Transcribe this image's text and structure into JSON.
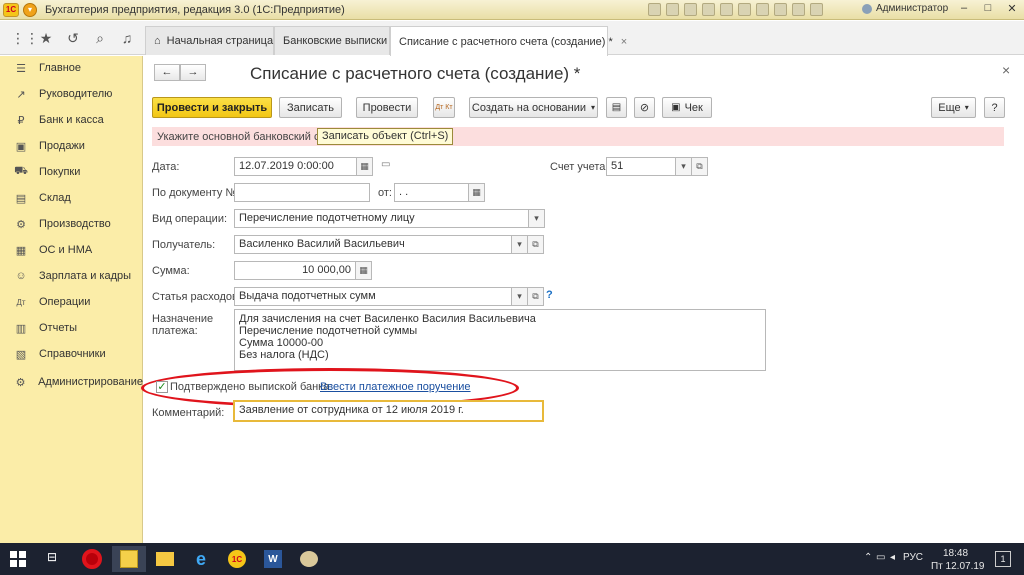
{
  "titlebar": {
    "logo": "1С",
    "title": "Бухгалтерия предприятия, редакция 3.0  (1С:Предприятие)",
    "user": "Администратор",
    "minimize": "–",
    "maximize": "□",
    "close": "✕"
  },
  "tabs": [
    {
      "label": "Начальная страница"
    },
    {
      "label": "Банковские выписки"
    },
    {
      "label": "Списание с расчетного счета (создание) *"
    }
  ],
  "sidebar": {
    "items": [
      {
        "label": "Главное",
        "icon": "☰"
      },
      {
        "label": "Руководителю",
        "icon": "↗"
      },
      {
        "label": "Банк и касса",
        "icon": "₽"
      },
      {
        "label": "Продажи",
        "icon": "▣"
      },
      {
        "label": "Покупки",
        "icon": "⛟"
      },
      {
        "label": "Склад",
        "icon": "▤"
      },
      {
        "label": "Производство",
        "icon": "⚙"
      },
      {
        "label": "ОС и НМА",
        "icon": "▦"
      },
      {
        "label": "Зарплата и кадры",
        "icon": "☺"
      },
      {
        "label": "Операции",
        "icon": "Дт"
      },
      {
        "label": "Отчеты",
        "icon": "▥"
      },
      {
        "label": "Справочники",
        "icon": "▧"
      },
      {
        "label": "Администрирование",
        "icon": "⚙"
      }
    ]
  },
  "form": {
    "title": "Списание с расчетного счета (создание) *",
    "close_glyph": "×",
    "back": "←",
    "forward": "→",
    "toolbar": {
      "post_close": "Провести и закрыть",
      "save": "Записать",
      "post": "Провести",
      "dt_kt": "Дт Кт",
      "create_based": "Создать на основании",
      "check": "Чек",
      "more": "Еще",
      "help": "?"
    },
    "warning": "Укажите основной банковский счет",
    "tooltip": "Записать объект (Ctrl+S)",
    "fields": {
      "date_label": "Дата:",
      "date_value": "12.07.2019  0:00:00",
      "account_label": "Счет учета:",
      "account_value": "51",
      "doc_label": "По документу №:",
      "doc_value": "",
      "from_label": "от:",
      "from_value": "  .  .",
      "op_label": "Вид операции:",
      "op_value": "Перечисление подотчетному лицу",
      "recipient_label": "Получатель:",
      "recipient_value": "Василенко Василий Васильевич",
      "sum_label": "Сумма:",
      "sum_value": "10 000,00",
      "expense_label": "Статья расходов:",
      "expense_value": "Выдача подотчетных сумм",
      "expense_help": "?",
      "purpose_label_1": "Назначение",
      "purpose_label_2": "платежа:",
      "purpose_lines": [
        "Для зачисления на счет Василенко Василия Васильевича",
        "Перечисление подотчетной суммы",
        "Сумма 10000-00",
        "Без налога (НДС)"
      ],
      "confirmed_label": "Подтверждено выпиской банка:",
      "confirmed_checked": true,
      "payment_order_link": "Ввести платежное поручение",
      "comment_label": "Комментарий:",
      "comment_value": "Заявление от сотрудника от 12 июля 2019 г."
    }
  },
  "taskbar": {
    "lang": "РУС",
    "time": "18:48",
    "date": "Пт 12.07.19",
    "notifications": "1"
  },
  "colors": {
    "sidebar": "#fbeda8",
    "primary_button": "#f2c615",
    "warning": "#fcdede",
    "annotation": "#e0141c",
    "link": "#1a4fa0"
  }
}
